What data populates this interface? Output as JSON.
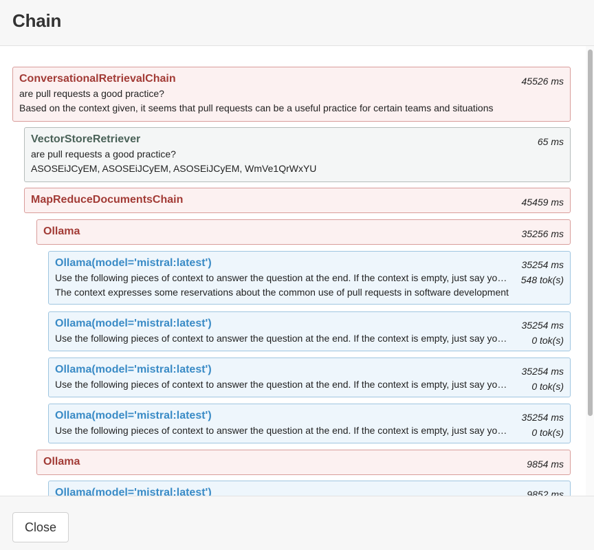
{
  "dialog": {
    "title": "Chain",
    "close_label": "Close"
  },
  "runs": [
    {
      "name": "ConversationalRetrievalChain",
      "duration": "45526 ms",
      "input": "are pull requests a good practice?",
      "output": "Based on the context given, it seems that pull requests can be a useful practice for certain teams and situations"
    },
    {
      "name": "VectorStoreRetriever",
      "duration": "65 ms",
      "input": "are pull requests a good practice?",
      "output": "ASOSEiJCyEM, ASOSEiJCyEM, ASOSEiJCyEM, WmVe1QrWxYU"
    },
    {
      "name": "MapReduceDocumentsChain",
      "duration": "45459 ms"
    },
    {
      "name": "Ollama",
      "duration": "35256 ms"
    },
    {
      "name": "Ollama(model='mistral:latest')",
      "duration": "35254 ms",
      "tokens": "548 tok(s)",
      "input": "Use the following pieces of context to answer the question at the end. If the context is empty, just say you don't know",
      "output": "The context expresses some reservations about the common use of pull requests in software development"
    },
    {
      "name": "Ollama(model='mistral:latest')",
      "duration": "35254 ms",
      "tokens": "0 tok(s)",
      "input": "Use the following pieces of context to answer the question at the end. If the context is empty, just say you don't know"
    },
    {
      "name": "Ollama(model='mistral:latest')",
      "duration": "35254 ms",
      "tokens": "0 tok(s)",
      "input": "Use the following pieces of context to answer the question at the end. If the context is empty, just say you don't know"
    },
    {
      "name": "Ollama(model='mistral:latest')",
      "duration": "35254 ms",
      "tokens": "0 tok(s)",
      "input": "Use the following pieces of context to answer the question at the end. If the context is empty, just say you don't know"
    },
    {
      "name": "Ollama",
      "duration": "9854 ms"
    },
    {
      "name": "Ollama(model='mistral:latest')",
      "duration": "9852 ms"
    }
  ]
}
